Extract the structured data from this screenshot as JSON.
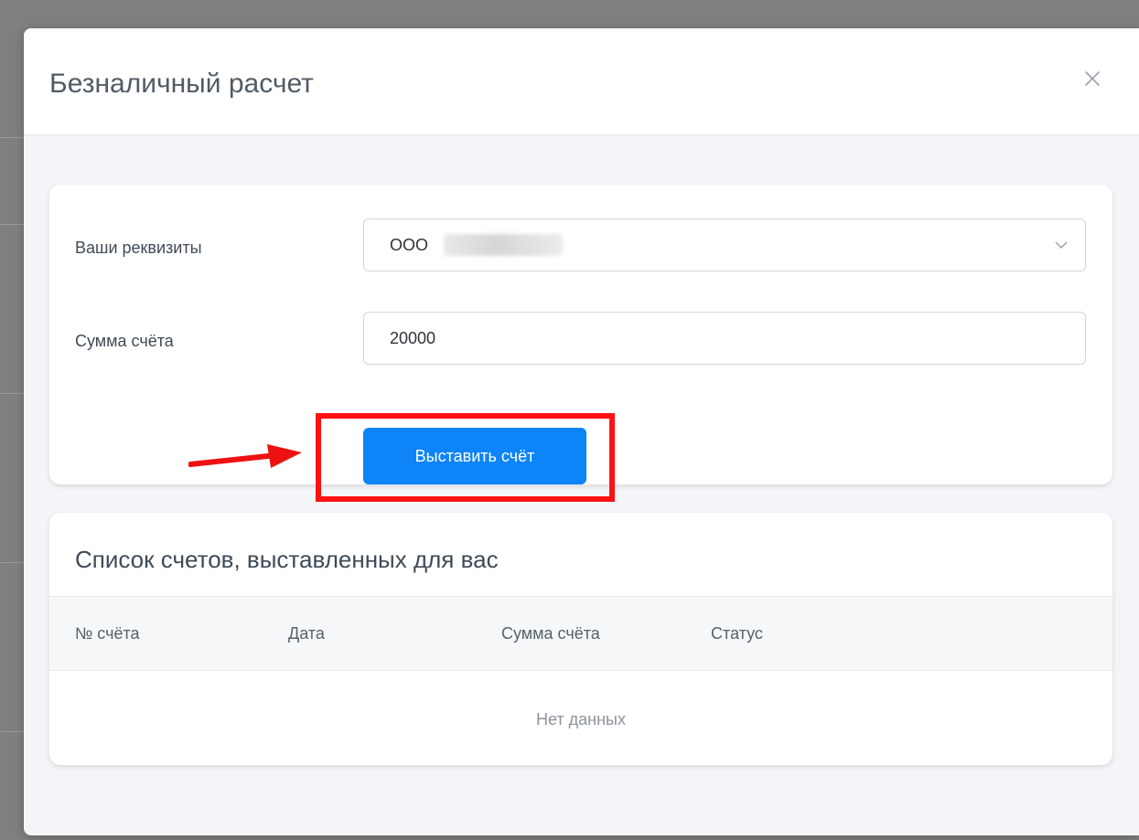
{
  "modal": {
    "title": "Безналичный расчет",
    "close_icon": "close-icon"
  },
  "form": {
    "requisites_label": "Ваши реквизиты",
    "requisites_value": "ООО",
    "requisites_icon": "chevron-down-icon",
    "amount_label": "Сумма счёта",
    "amount_value": "20000",
    "submit_label": "Выставить счёт"
  },
  "annotation": {
    "highlight_color": "#ff1111",
    "arrow_icon": "arrow-right-icon"
  },
  "invoices": {
    "title": "Список счетов, выставленных для вас",
    "columns": [
      "№ счёта",
      "Дата",
      "Сумма счёта",
      "Статус"
    ],
    "empty_text": "Нет данных"
  },
  "colors": {
    "primary": "#0d84f7",
    "annotation_red": "#ff1111"
  }
}
